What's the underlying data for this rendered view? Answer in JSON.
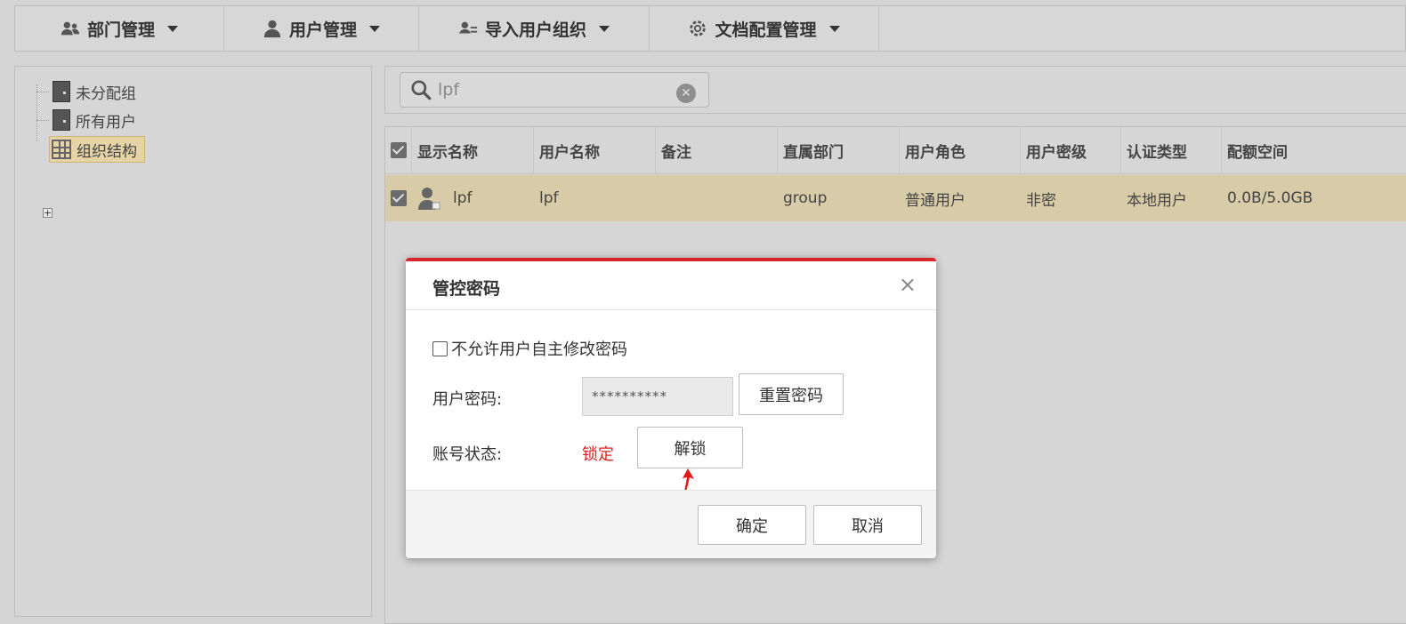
{
  "toolbar": {
    "items": [
      {
        "label": "部门管理",
        "icon": "group-users-icon"
      },
      {
        "label": "用户管理",
        "icon": "user-icon"
      },
      {
        "label": "导入用户组织",
        "icon": "import-users-icon"
      },
      {
        "label": "文档配置管理",
        "icon": "gear-icon"
      }
    ]
  },
  "tree": {
    "nodes": [
      {
        "label": "未分配组",
        "icon": "door-icon"
      },
      {
        "label": "所有用户",
        "icon": "door-icon"
      },
      {
        "label": "组织结构",
        "icon": "organization-grid-icon",
        "selected": true,
        "expander": "+"
      }
    ]
  },
  "search": {
    "value": "lpf",
    "placeholder": ""
  },
  "table": {
    "headers": [
      "显示名称",
      "用户名称",
      "备注",
      "直属部门",
      "用户角色",
      "用户密级",
      "认证类型",
      "配额空间"
    ],
    "rows": [
      {
        "display_name": "lpf",
        "user_name": "lpf",
        "note": "",
        "department": "group",
        "role": "普通用户",
        "security_level": "非密",
        "auth_type": "本地用户",
        "quota": "0.0B/5.0GB",
        "checked": true
      }
    ]
  },
  "modal": {
    "title": "管控密码",
    "close_label": "×",
    "disallow_change_label": "不允许用户自主修改密码",
    "password_label": "用户密码:",
    "password_value": "**********",
    "reset_button": "重置密码",
    "status_label": "账号状态:",
    "status_value": "锁定",
    "unlock_button": "解锁",
    "ok_button": "确定",
    "cancel_button": "取消"
  },
  "colors": {
    "accent_red": "#d9262a",
    "locked_red": "#e02020",
    "selected_row": "#d8cba8",
    "selected_node": "#e6d3a6"
  }
}
